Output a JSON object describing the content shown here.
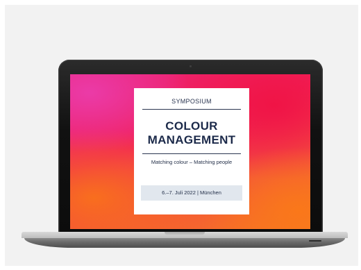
{
  "poster": {
    "kicker": "SYMPOSIUM",
    "title_line1": "COLOUR",
    "title_line2": "MANAGEMENT",
    "subtitle": "Matching colour – Matching people",
    "date": "6.–7. Juli 2022 | München"
  },
  "colors": {
    "background": "#f2f2f2",
    "laptop_bezel": "#111111",
    "card_text": "#1c2a4a",
    "date_box": "#e1e7ee",
    "gradient_pink": "#e9247e",
    "gradient_red": "#f2215a",
    "gradient_orange": "#f67a22"
  }
}
